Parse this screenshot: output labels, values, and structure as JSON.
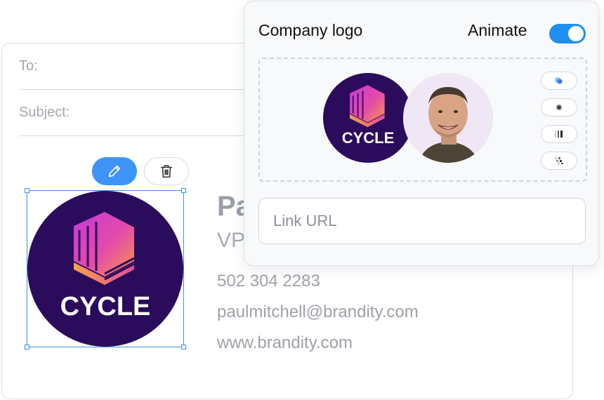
{
  "composer": {
    "to_label": "To:",
    "subject_label": "Subject:"
  },
  "signature": {
    "name_partial": "Pa",
    "role_partial": "VP",
    "phone": "502 304 2283",
    "email": "paulmitchell@brandity.com",
    "website": "www.brandity.com",
    "logo_text": "CYCLE"
  },
  "toolbar": {
    "edit_icon": "pencil-icon",
    "delete_icon": "trash-icon"
  },
  "panel": {
    "title": "Company logo",
    "animate_label": "Animate",
    "animate_enabled": true,
    "preview_logo_text": "CYCLE",
    "link_placeholder": "Link URL",
    "animation_options": [
      "bubbles-icon",
      "dot-icon",
      "bars-icon",
      "pixels-icon"
    ]
  },
  "colors": {
    "accent": "#1f8ef1",
    "edit_button": "#3e93f6",
    "logo_background": "#2b0b5c",
    "selection": "#3d8ee6"
  }
}
